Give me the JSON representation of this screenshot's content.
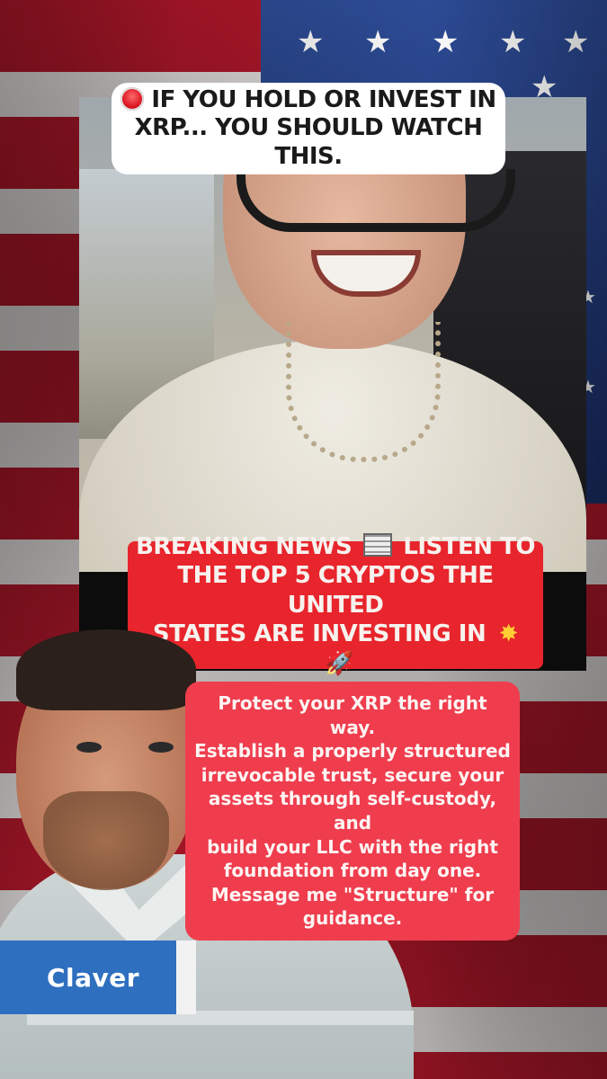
{
  "top_caption": {
    "line1": "IF YOU HOLD OR INVEST IN",
    "line2": "XRP... YOU SHOULD WATCH THIS."
  },
  "breaking_news": {
    "line1a": "BREAKING NEWS",
    "line1b": "LISTEN TO",
    "line2": "THE TOP 5 CRYPTOS THE UNITED",
    "line3": "STATES ARE INVESTING IN"
  },
  "message": {
    "lines": [
      "Protect your XRP the right way.",
      "Establish a properly structured",
      "irrevocable trust, secure your",
      "assets through self-custody, and",
      "build your LLC with the right",
      "foundation from day one.",
      "Message me \"Structure\" for",
      "guidance."
    ]
  },
  "name_tag": {
    "label": "Claver"
  },
  "colors": {
    "caption_bg": "#ffffff",
    "breaking_bg": "#e8252c",
    "message_bg": "#ef3d4e",
    "name_tag_bg": "#2f6fbf"
  },
  "icons": [
    "siren-icon",
    "newspaper-icon",
    "explosion-icon",
    "rocket-icon"
  ]
}
